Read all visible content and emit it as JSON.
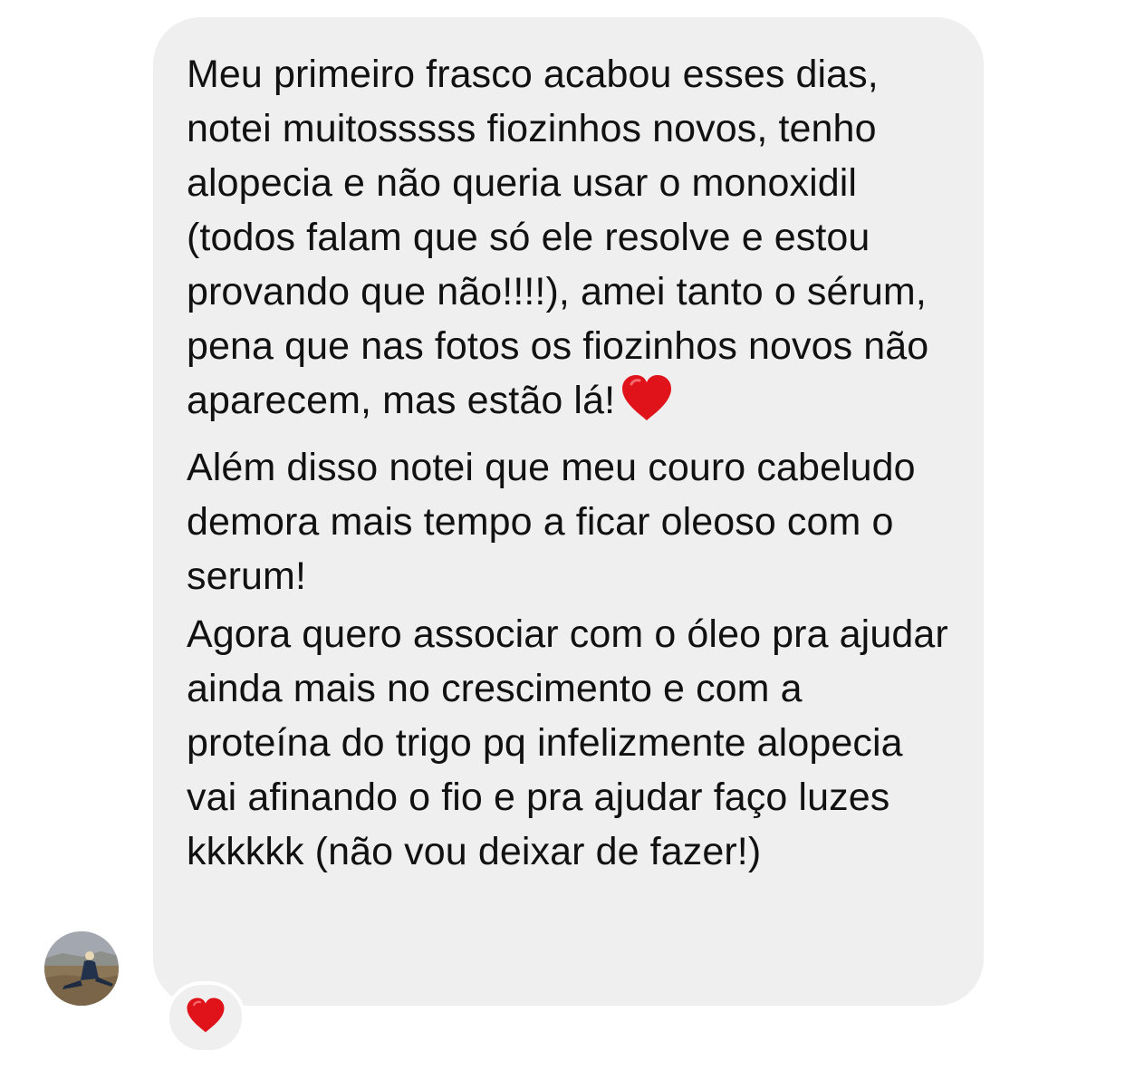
{
  "message": {
    "paragraphs": [
      {
        "text": "Meu primeiro frasco acabou esses dias, notei muitosssss fiozinhos novos, tenho alopecia e não queria usar o monoxidil (todos falam que só ele resolve e estou provando que não!!!!), amei tanto o sérum, pena que nas fotos os fiozinhos novos não aparecem, mas estão lá!",
        "trailing_emoji": "red-heart-icon"
      },
      {
        "text": "Além disso notei que meu couro cabeludo demora mais tempo a ficar oleoso com o serum!"
      },
      {
        "text": "Agora quero associar com o óleo pra ajudar ainda mais no crescimento e com a proteína do trigo pq infelizmente alopecia vai afinando o fio e pra ajudar faço luzes kkkkkk (não vou deixar de fazer!)"
      }
    ],
    "reaction": "red-heart-icon"
  },
  "sender": {
    "avatar": "profile-photo"
  },
  "colors": {
    "bubble_background": "#efefef",
    "text": "#111111",
    "heart": "#e0131b"
  }
}
